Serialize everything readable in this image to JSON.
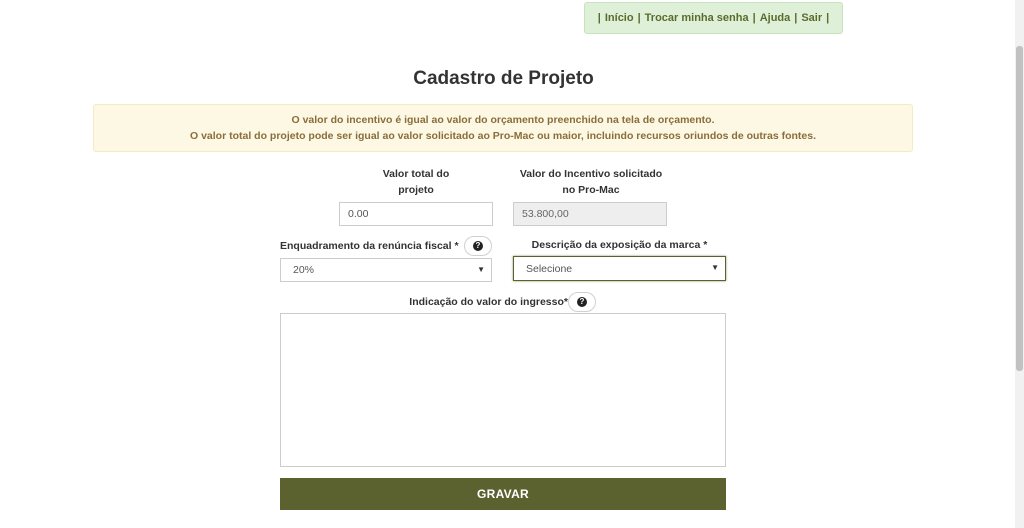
{
  "nav": {
    "items": [
      "Início",
      "Trocar minha senha",
      "Ajuda",
      "Sair"
    ],
    "separator": "|"
  },
  "page_title": "Cadastro de Projeto",
  "alert": {
    "line1": "O valor do incentivo é igual ao valor do orçamento preenchido na tela de orçamento.",
    "line2": "O valor total do projeto pode ser igual ao valor solicitado ao Pro-Mac ou maior, incluindo recursos oriundos de outras fontes."
  },
  "form": {
    "valor_total": {
      "label_line1": "Valor total do",
      "label_line2": "projeto",
      "value": "0.00"
    },
    "valor_incentivo": {
      "label_line1": "Valor do Incentivo solicitado",
      "label_line2": "no Pro-Mac",
      "value": "53.800,00"
    },
    "enquadramento": {
      "label": "Enquadramento da renúncia fiscal *",
      "selected": "20%"
    },
    "exposicao_marca": {
      "label": "Descrição da exposição da marca *",
      "selected": "Selecione"
    },
    "valor_ingresso": {
      "label": "Indicação do valor do ingresso*",
      "value": ""
    },
    "submit_label": "GRAVAR"
  },
  "icons": {
    "help": "question-circle-icon",
    "caret": "caret-down-icon"
  },
  "colors": {
    "primary": "#5b6230",
    "nav_bg": "#dff0d8",
    "alert_bg": "#fcf8e3",
    "alert_text": "#8a6d3b"
  }
}
